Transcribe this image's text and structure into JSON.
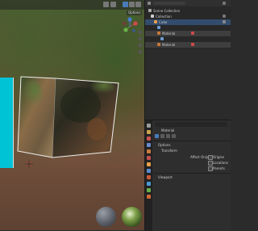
{
  "viewport": {
    "header_label": "Options",
    "gizmo_axes": [
      "X",
      "Y",
      "Z"
    ]
  },
  "outliner": {
    "header": "Scene Collection",
    "rows": [
      {
        "label": "Scene Collection"
      },
      {
        "label": "Collection"
      },
      {
        "label": "Cube"
      },
      {
        "label": ""
      },
      {
        "label": "Material"
      },
      {
        "label": ""
      },
      {
        "label": "Material"
      },
      {
        "label": ""
      }
    ]
  },
  "properties": {
    "object_name": "Material",
    "sections": {
      "options": "Options",
      "transform": "Transform",
      "viewport": "Viewport"
    },
    "fields": {
      "label": "Affect Only",
      "origins": "Origins",
      "locations": "Locations",
      "parents": "Parents"
    }
  },
  "colors": {
    "accent": "#4a7bb8",
    "cyan_object": "#00c3d6",
    "selection": "#334c6e"
  }
}
